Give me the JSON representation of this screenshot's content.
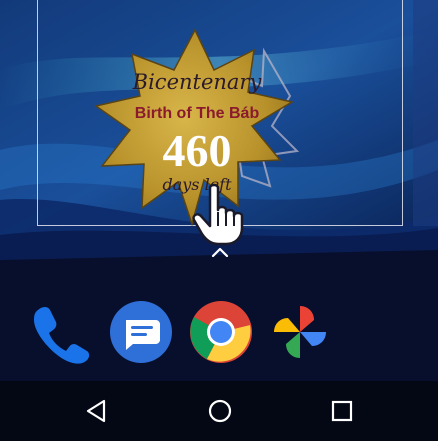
{
  "widget": {
    "line1": "Bicentenary",
    "line2": "Birth of The Báb",
    "count": "460",
    "line3": "days left"
  },
  "dock": {
    "apps": [
      {
        "name": "Phone",
        "icon": "phone-icon"
      },
      {
        "name": "Messages",
        "icon": "messages-icon"
      },
      {
        "name": "Chrome",
        "icon": "chrome-icon"
      },
      {
        "name": "Photos",
        "icon": "photos-icon"
      }
    ]
  },
  "navigation": {
    "buttons": [
      "back-icon",
      "home-icon",
      "recents-icon"
    ]
  },
  "colors": {
    "star_gold": "#b8912a",
    "title_maroon": "#8a1a2c",
    "phone_blue": "#1a73e8",
    "messages_blue": "#2f6fd8"
  }
}
